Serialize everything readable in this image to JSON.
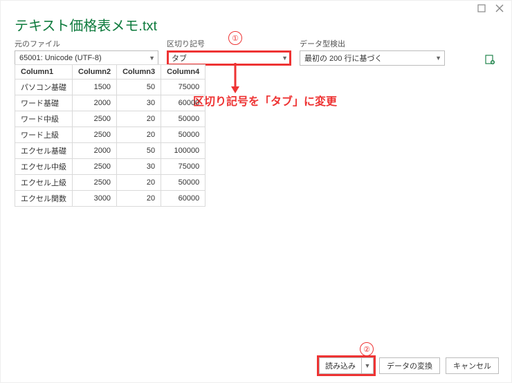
{
  "title": "テキスト価格表メモ.txt",
  "labels": {
    "origin": "元のファイル",
    "delimiter": "区切り記号",
    "detect": "データ型検出"
  },
  "dropdowns": {
    "origin": "65001: Unicode (UTF-8)",
    "delimiter": "タブ",
    "detect": "最初の 200 行に基づく"
  },
  "callouts": {
    "n1": "①",
    "n2": "②",
    "text": "区切り記号を「タブ」に変更"
  },
  "table": {
    "headers": [
      "Column1",
      "Column2",
      "Column3",
      "Column4"
    ],
    "rows": [
      [
        "パソコン基礎",
        "1500",
        "50",
        "75000"
      ],
      [
        "ワード基礎",
        "2000",
        "30",
        "60000"
      ],
      [
        "ワード中級",
        "2500",
        "20",
        "50000"
      ],
      [
        "ワード上級",
        "2500",
        "20",
        "50000"
      ],
      [
        "エクセル基礎",
        "2000",
        "50",
        "100000"
      ],
      [
        "エクセル中級",
        "2500",
        "30",
        "75000"
      ],
      [
        "エクセル上級",
        "2500",
        "20",
        "50000"
      ],
      [
        "エクセル関数",
        "3000",
        "20",
        "60000"
      ]
    ]
  },
  "buttons": {
    "load": "読み込み",
    "transform": "データの変換",
    "cancel": "キャンセル"
  }
}
